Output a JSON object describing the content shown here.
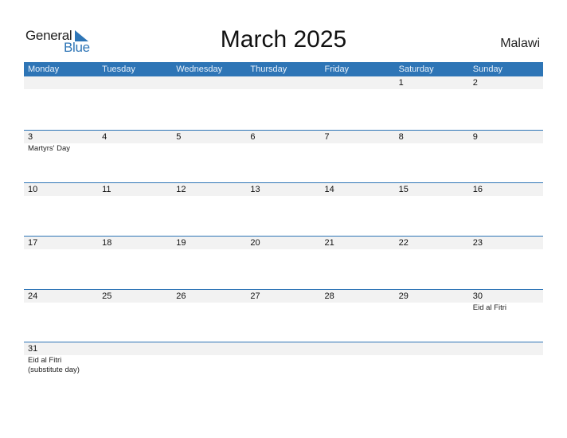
{
  "logo": {
    "line1": "General",
    "line2": "Blue"
  },
  "header": {
    "title": "March 2025",
    "country": "Malawi"
  },
  "weekdays": [
    "Monday",
    "Tuesday",
    "Wednesday",
    "Thursday",
    "Friday",
    "Saturday",
    "Sunday"
  ],
  "weeks": [
    [
      {
        "day": "",
        "holiday": ""
      },
      {
        "day": "",
        "holiday": ""
      },
      {
        "day": "",
        "holiday": ""
      },
      {
        "day": "",
        "holiday": ""
      },
      {
        "day": "",
        "holiday": ""
      },
      {
        "day": "1",
        "holiday": ""
      },
      {
        "day": "2",
        "holiday": ""
      }
    ],
    [
      {
        "day": "3",
        "holiday": "Martyrs' Day"
      },
      {
        "day": "4",
        "holiday": ""
      },
      {
        "day": "5",
        "holiday": ""
      },
      {
        "day": "6",
        "holiday": ""
      },
      {
        "day": "7",
        "holiday": ""
      },
      {
        "day": "8",
        "holiday": ""
      },
      {
        "day": "9",
        "holiday": ""
      }
    ],
    [
      {
        "day": "10",
        "holiday": ""
      },
      {
        "day": "11",
        "holiday": ""
      },
      {
        "day": "12",
        "holiday": ""
      },
      {
        "day": "13",
        "holiday": ""
      },
      {
        "day": "14",
        "holiday": ""
      },
      {
        "day": "15",
        "holiday": ""
      },
      {
        "day": "16",
        "holiday": ""
      }
    ],
    [
      {
        "day": "17",
        "holiday": ""
      },
      {
        "day": "18",
        "holiday": ""
      },
      {
        "day": "19",
        "holiday": ""
      },
      {
        "day": "20",
        "holiday": ""
      },
      {
        "day": "21",
        "holiday": ""
      },
      {
        "day": "22",
        "holiday": ""
      },
      {
        "day": "23",
        "holiday": ""
      }
    ],
    [
      {
        "day": "24",
        "holiday": ""
      },
      {
        "day": "25",
        "holiday": ""
      },
      {
        "day": "26",
        "holiday": ""
      },
      {
        "day": "27",
        "holiday": ""
      },
      {
        "day": "28",
        "holiday": ""
      },
      {
        "day": "29",
        "holiday": ""
      },
      {
        "day": "30",
        "holiday": "Eid al Fitri"
      }
    ],
    [
      {
        "day": "31",
        "holiday": "Eid al Fitri\n(substitute day)"
      },
      {
        "day": "",
        "holiday": ""
      },
      {
        "day": "",
        "holiday": ""
      },
      {
        "day": "",
        "holiday": ""
      },
      {
        "day": "",
        "holiday": ""
      },
      {
        "day": "",
        "holiday": ""
      },
      {
        "day": "",
        "holiday": ""
      }
    ]
  ],
  "colors": {
    "accent": "#2e75b6",
    "date_band": "#f2f2f2"
  }
}
